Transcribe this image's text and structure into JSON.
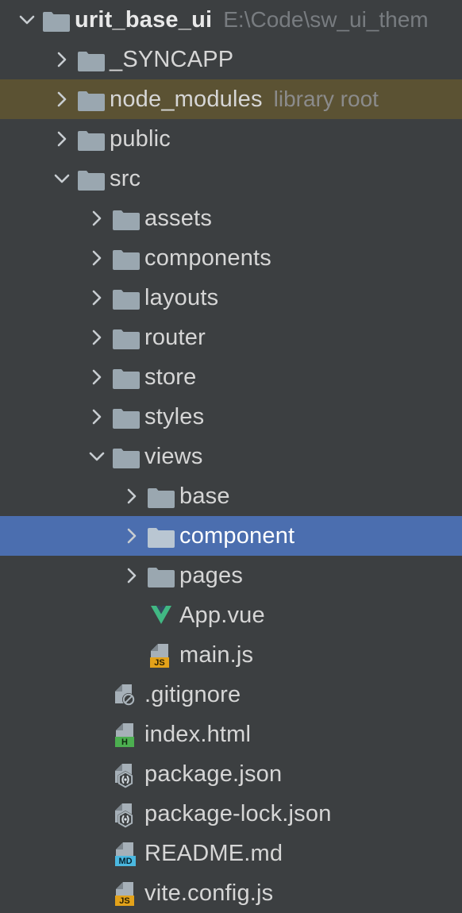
{
  "panel": {
    "name": "project-tool-window",
    "background_color": "#3c3f41",
    "selection_color": "#4b6eaf",
    "excluded_color": "#5b5233",
    "text_color": "#d6d6d6",
    "muted_text_color": "#8b8b8b",
    "folder_icon_color": "#9aa7b0"
  },
  "tree": {
    "nodes": [
      {
        "label": "urit_base_ui",
        "hint": "E:\\Code\\sw_ui_them",
        "depth": 0,
        "kind": "folder",
        "icon": "folder-icon",
        "state": "expanded",
        "bold": true,
        "selected": false,
        "excluded": false
      },
      {
        "label": "_SYNCAPP",
        "hint": "",
        "depth": 1,
        "kind": "folder",
        "icon": "folder-icon",
        "state": "collapsed",
        "bold": false,
        "selected": false,
        "excluded": false
      },
      {
        "label": "node_modules",
        "hint": "library root",
        "depth": 1,
        "kind": "folder",
        "icon": "folder-icon",
        "state": "collapsed",
        "bold": false,
        "selected": false,
        "excluded": true
      },
      {
        "label": "public",
        "hint": "",
        "depth": 1,
        "kind": "folder",
        "icon": "folder-icon",
        "state": "collapsed",
        "bold": false,
        "selected": false,
        "excluded": false
      },
      {
        "label": "src",
        "hint": "",
        "depth": 1,
        "kind": "folder",
        "icon": "folder-icon",
        "state": "expanded",
        "bold": false,
        "selected": false,
        "excluded": false
      },
      {
        "label": "assets",
        "hint": "",
        "depth": 2,
        "kind": "folder",
        "icon": "folder-icon",
        "state": "collapsed",
        "bold": false,
        "selected": false,
        "excluded": false
      },
      {
        "label": "components",
        "hint": "",
        "depth": 2,
        "kind": "folder",
        "icon": "folder-icon",
        "state": "collapsed",
        "bold": false,
        "selected": false,
        "excluded": false
      },
      {
        "label": "layouts",
        "hint": "",
        "depth": 2,
        "kind": "folder",
        "icon": "folder-icon",
        "state": "collapsed",
        "bold": false,
        "selected": false,
        "excluded": false
      },
      {
        "label": "router",
        "hint": "",
        "depth": 2,
        "kind": "folder",
        "icon": "folder-icon",
        "state": "collapsed",
        "bold": false,
        "selected": false,
        "excluded": false
      },
      {
        "label": "store",
        "hint": "",
        "depth": 2,
        "kind": "folder",
        "icon": "folder-icon",
        "state": "collapsed",
        "bold": false,
        "selected": false,
        "excluded": false
      },
      {
        "label": "styles",
        "hint": "",
        "depth": 2,
        "kind": "folder",
        "icon": "folder-icon",
        "state": "collapsed",
        "bold": false,
        "selected": false,
        "excluded": false
      },
      {
        "label": "views",
        "hint": "",
        "depth": 2,
        "kind": "folder",
        "icon": "folder-icon",
        "state": "expanded",
        "bold": false,
        "selected": false,
        "excluded": false
      },
      {
        "label": "base",
        "hint": "",
        "depth": 3,
        "kind": "folder",
        "icon": "folder-icon",
        "state": "collapsed",
        "bold": false,
        "selected": false,
        "excluded": false
      },
      {
        "label": "component",
        "hint": "",
        "depth": 3,
        "kind": "folder",
        "icon": "folder-icon",
        "state": "collapsed",
        "bold": false,
        "selected": true,
        "excluded": false
      },
      {
        "label": "pages",
        "hint": "",
        "depth": 3,
        "kind": "folder",
        "icon": "folder-icon",
        "state": "collapsed",
        "bold": false,
        "selected": false,
        "excluded": false
      },
      {
        "label": "App.vue",
        "hint": "",
        "depth": 3,
        "kind": "file",
        "icon": "vue-file-icon",
        "state": "leaf",
        "bold": false,
        "selected": false,
        "excluded": false
      },
      {
        "label": "main.js",
        "hint": "",
        "depth": 3,
        "kind": "file",
        "icon": "js-file-icon",
        "state": "leaf",
        "bold": false,
        "selected": false,
        "excluded": false
      },
      {
        "label": ".gitignore",
        "hint": "",
        "depth": 2,
        "kind": "file",
        "icon": "gitignore-file-icon",
        "state": "leaf",
        "bold": false,
        "selected": false,
        "excluded": false
      },
      {
        "label": "index.html",
        "hint": "",
        "depth": 2,
        "kind": "file",
        "icon": "html-file-icon",
        "state": "leaf",
        "bold": false,
        "selected": false,
        "excluded": false
      },
      {
        "label": "package.json",
        "hint": "",
        "depth": 2,
        "kind": "file",
        "icon": "json-node-file-icon",
        "state": "leaf",
        "bold": false,
        "selected": false,
        "excluded": false
      },
      {
        "label": "package-lock.json",
        "hint": "",
        "depth": 2,
        "kind": "file",
        "icon": "json-node-file-icon",
        "state": "leaf",
        "bold": false,
        "selected": false,
        "excluded": false
      },
      {
        "label": "README.md",
        "hint": "",
        "depth": 2,
        "kind": "file",
        "icon": "markdown-file-icon",
        "state": "leaf",
        "bold": false,
        "selected": false,
        "excluded": false
      },
      {
        "label": "vite.config.js",
        "hint": "",
        "depth": 2,
        "kind": "file",
        "icon": "js-file-icon",
        "state": "leaf",
        "bold": false,
        "selected": false,
        "excluded": false
      }
    ]
  },
  "badges": {
    "js": "JS",
    "html": "H",
    "markdown": "MD"
  }
}
